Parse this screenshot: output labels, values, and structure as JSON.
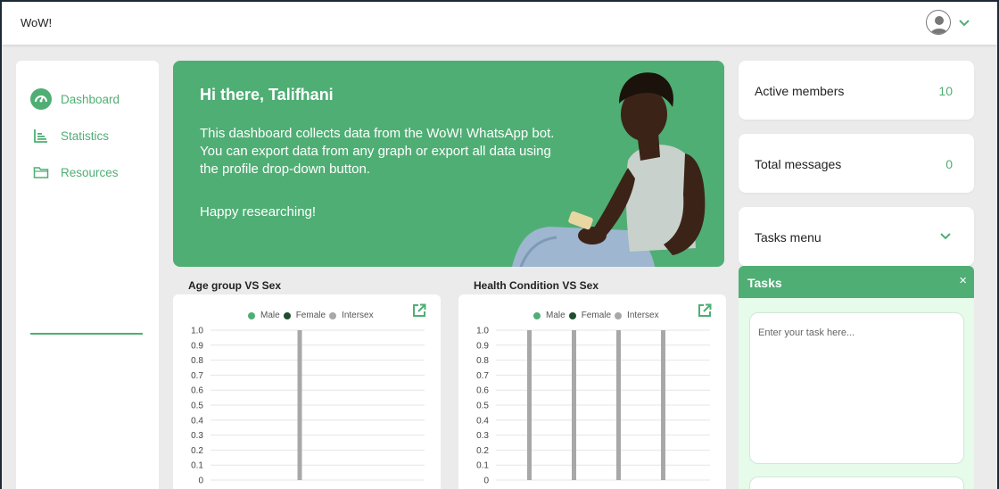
{
  "header": {
    "brand": "WoW!",
    "icons": {
      "avatar": "user-avatar-icon",
      "menu": "chevron-down-icon"
    }
  },
  "sidebar": {
    "items": [
      {
        "label": "Dashboard",
        "icon": "gauge-icon"
      },
      {
        "label": "Statistics",
        "icon": "bar-chart-icon"
      },
      {
        "label": "Resources",
        "icon": "folder-icon"
      }
    ]
  },
  "hero": {
    "title": "Hi there, Talifhani",
    "body": "This dashboard collects data from the WoW! WhatsApp bot. You can export data from any graph or export all data using the profile drop-down button.",
    "sign_off": "Happy researching!"
  },
  "charts": [
    {
      "title": "Age group VS Sex"
    },
    {
      "title": "Health Condition VS Sex"
    }
  ],
  "stats": {
    "active_members": {
      "label": "Active members",
      "value": "10"
    },
    "total_messages": {
      "label": "Total messages",
      "value": "0"
    },
    "tasks_menu": {
      "label": "Tasks menu"
    }
  },
  "tasks": {
    "title": "Tasks",
    "close": "×",
    "placeholder": "Enter your task here..."
  },
  "colors": {
    "accent": "#4fae74",
    "male": "#4fae74",
    "female": "#1f4d30",
    "intersex": "#a8a8a8"
  },
  "chart_data": [
    {
      "type": "bar",
      "title": "Age group VS Sex",
      "legend": [
        "Male",
        "Female",
        "Intersex"
      ],
      "yticks": [
        "1.0",
        "0.9",
        "0.8",
        "0.7",
        "0.6",
        "0.5",
        "0.4",
        "0.3",
        "0.2",
        "0.1",
        "0"
      ],
      "ylim": [
        0,
        1
      ],
      "grid": true,
      "legend_position": "top",
      "series": [
        {
          "name": "Male",
          "values": [
            0
          ]
        },
        {
          "name": "Female",
          "values": [
            0
          ]
        },
        {
          "name": "Intersex",
          "values": [
            1
          ]
        }
      ]
    },
    {
      "type": "bar",
      "title": "Health Condition VS Sex",
      "legend": [
        "Male",
        "Female",
        "Intersex"
      ],
      "yticks": [
        "1.0",
        "0.9",
        "0.8",
        "0.7",
        "0.6",
        "0.5",
        "0.4",
        "0.3",
        "0.2",
        "0.1",
        "0"
      ],
      "ylim": [
        0,
        1
      ],
      "grid": true,
      "legend_position": "top",
      "series": [
        {
          "name": "Male",
          "values": [
            0,
            0,
            0,
            0
          ]
        },
        {
          "name": "Female",
          "values": [
            0,
            0,
            0,
            0
          ]
        },
        {
          "name": "Intersex",
          "values": [
            1,
            1,
            1,
            1
          ]
        }
      ]
    }
  ]
}
